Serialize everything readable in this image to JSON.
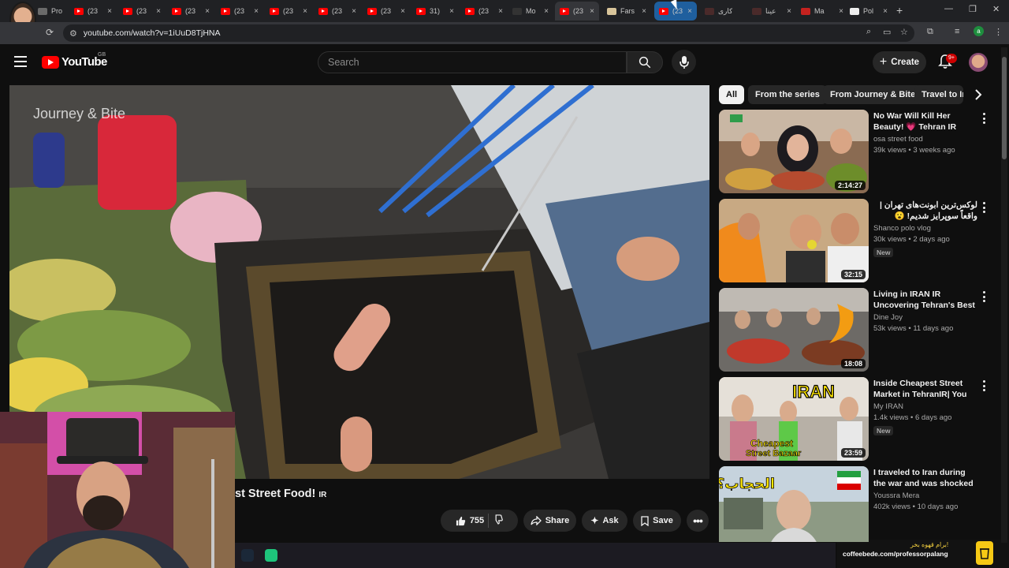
{
  "browser": {
    "tabs": [
      {
        "title": "Pro",
        "icon": "profile-favicon"
      },
      {
        "title": "(23",
        "icon": "youtube-favicon"
      },
      {
        "title": "(23",
        "icon": "youtube-favicon"
      },
      {
        "title": "(23",
        "icon": "youtube-favicon"
      },
      {
        "title": "(23",
        "icon": "youtube-favicon"
      },
      {
        "title": "(23",
        "icon": "youtube-favicon"
      },
      {
        "title": "(23",
        "icon": "youtube-favicon"
      },
      {
        "title": "(23",
        "icon": "youtube-favicon"
      },
      {
        "title": "31)",
        "icon": "youtube-favicon"
      },
      {
        "title": "(23",
        "icon": "youtube-favicon"
      },
      {
        "title": "Mo",
        "icon": "app-favicon"
      },
      {
        "title": "(23",
        "icon": "youtube-favicon"
      },
      {
        "title": "Fars",
        "icon": "edit-favicon"
      },
      {
        "title": "(23",
        "icon": "youtube-favicon"
      },
      {
        "title": "کاری",
        "icon": "app-favicon"
      },
      {
        "title": "عینا",
        "icon": "app-favicon"
      },
      {
        "title": "Ma",
        "icon": "mail-favicon"
      },
      {
        "title": "Pol",
        "icon": "wikipedia-favicon"
      }
    ],
    "close_glyph": "×",
    "new_tab_glyph": "+",
    "url": "youtube.com/watch?v=1iUuD8TjHNA",
    "profile_initial": "a"
  },
  "youtube": {
    "logo_text": "YouTube",
    "country": "GB",
    "search_placeholder": "Search",
    "create_label": "Create",
    "notification_count": "9+"
  },
  "player": {
    "watermark": "Journey & Bite",
    "title_visible": "st Street Food! ",
    "title_flag": "IR"
  },
  "actions": {
    "likes": "755",
    "share": "Share",
    "ask": "Ask",
    "save": "Save"
  },
  "chips": [
    "All",
    "From the series",
    "From Journey & Bite",
    "Travel to Ir"
  ],
  "recommendations": [
    {
      "title": "No War Will Kill Her Beauty! 💗 Tehran IR Inside Iran's ...",
      "channel": "osa street food",
      "meta": "39k views • 3 weeks ago",
      "duration": "2:14:27",
      "badge": ""
    },
    {
      "title": "لوکس‌ترین ابونت‌های تهران | واقعاً سوپرایز شدیم! 😮",
      "channel": "Shanco polo vlog",
      "meta": "30k views • 2 days ago",
      "duration": "32:15",
      "badge": "New"
    },
    {
      "title": "Living in IRAN IR Uncovering Tehran's Best Street Food ...",
      "channel": "Dine Joy",
      "meta": "53k views • 11 days ago",
      "duration": "18:08",
      "badge": ""
    },
    {
      "title": "Inside Cheapest Street Market in TehranIR| You Ca...",
      "channel": "My IRAN",
      "meta": "1.4k views • 6 days ago",
      "duration": "23:59",
      "badge": "New"
    },
    {
      "title": "I traveled to Iran during the war and was shocked by ...",
      "channel": "Youssra Mera",
      "meta": "402k views • 10 days ago",
      "duration": "",
      "badge": ""
    }
  ],
  "thumb_texts": {
    "r4_big": "IRAN",
    "r4_caption_1": "Cheapest",
    "r4_caption_2": "Street Bazaar",
    "r5_arabic": "الحجاب؟"
  },
  "promo": {
    "arabic": "برام قهوه بخر!",
    "text": "coffeebede.com/professorpalang"
  },
  "colors": {
    "background": "#0f0f0f",
    "brand_red": "#ff0000",
    "chip_active": "#f1f1f1",
    "secondary_text": "#aaaaaa"
  }
}
